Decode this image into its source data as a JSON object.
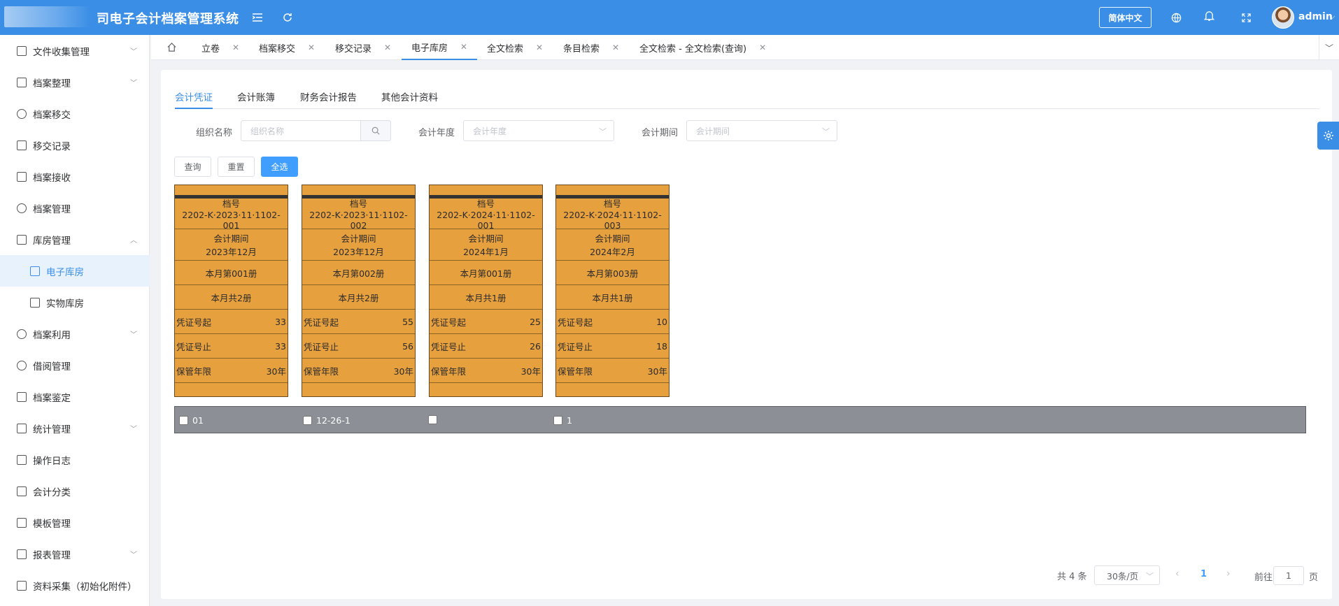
{
  "header": {
    "title": "司电子会计档案管理系统",
    "lang_button": "简体中文",
    "user_name": "admin",
    "icons": [
      "menu-fold-icon",
      "refresh-icon",
      "globe-icon",
      "bell-icon",
      "fullscreen-icon"
    ]
  },
  "sidebar": {
    "items": [
      {
        "label": "文件收集管理",
        "icon": "document-icon",
        "expandable": true
      },
      {
        "label": "档案整理",
        "icon": "grid-icon",
        "expandable": true
      },
      {
        "label": "档案移交",
        "icon": "power-icon"
      },
      {
        "label": "移交记录",
        "icon": "record-icon"
      },
      {
        "label": "档案接收",
        "icon": "receive-icon"
      },
      {
        "label": "档案管理",
        "icon": "manage-icon"
      },
      {
        "label": "库房管理",
        "icon": "warehouse-icon",
        "expanded": true
      },
      {
        "label": "电子库房",
        "icon": "laptop-icon",
        "sub": true,
        "active": true
      },
      {
        "label": "实物库房",
        "icon": "document-icon",
        "sub": true
      },
      {
        "label": "档案利用",
        "icon": "reuse-icon",
        "expandable": true
      },
      {
        "label": "借阅管理",
        "icon": "registered-icon"
      },
      {
        "label": "档案鉴定",
        "icon": "inspect-icon"
      },
      {
        "label": "统计管理",
        "icon": "stats-icon",
        "expandable": true
      },
      {
        "label": "操作日志",
        "icon": "log-icon"
      },
      {
        "label": "会计分类",
        "icon": "category-icon"
      },
      {
        "label": "模板管理",
        "icon": "template-icon"
      },
      {
        "label": "报表管理",
        "icon": "report-icon",
        "expandable": true
      },
      {
        "label": "资料采集（初始化附件）",
        "icon": "edit-icon"
      }
    ]
  },
  "tabs": [
    {
      "label": "立卷"
    },
    {
      "label": "档案移交"
    },
    {
      "label": "移交记录"
    },
    {
      "label": "电子库房",
      "active": true
    },
    {
      "label": "全文检索"
    },
    {
      "label": "条目检索"
    },
    {
      "label": "全文检索 - 全文检索(查询)"
    }
  ],
  "subtabs": [
    "会计凭证",
    "会计账簿",
    "财务会计报告",
    "其他会计资料"
  ],
  "filters": {
    "org_label": "组织名称",
    "org_placeholder": "组织名称",
    "year_label": "会计年度",
    "year_placeholder": "会计年度",
    "period_label": "会计期间",
    "period_placeholder": "会计期间"
  },
  "buttons": {
    "query": "查询",
    "reset": "重置",
    "select_all": "全选"
  },
  "boxes": [
    {
      "dh_label": "档号",
      "dh": "2202-K·2023·11·1102-001",
      "period_label": "会计期间",
      "period": "2023年12月",
      "vol": "本月第001册",
      "total": "本月共2册",
      "start_label": "凭证号起",
      "start": "33",
      "end_label": "凭证号止",
      "end": "33",
      "keep_label": "保管年限",
      "keep": "30年"
    },
    {
      "dh_label": "档号",
      "dh": "2202-K·2023·11·1102-002",
      "period_label": "会计期间",
      "period": "2023年12月",
      "vol": "本月第002册",
      "total": "本月共2册",
      "start_label": "凭证号起",
      "start": "55",
      "end_label": "凭证号止",
      "end": "56",
      "keep_label": "保管年限",
      "keep": "30年"
    },
    {
      "dh_label": "档号",
      "dh": "2202-K·2024·11·1102-001",
      "period_label": "会计期间",
      "period": "2024年1月",
      "vol": "本月第001册",
      "total": "本月共1册",
      "start_label": "凭证号起",
      "start": "25",
      "end_label": "凭证号止",
      "end": "26",
      "keep_label": "保管年限",
      "keep": "30年"
    },
    {
      "dh_label": "档号",
      "dh": "2202-K·2024·11·1102-003",
      "period_label": "会计期间",
      "period": "2024年2月",
      "vol": "本月第003册",
      "total": "本月共1册",
      "start_label": "凭证号起",
      "start": "10",
      "end_label": "凭证号止",
      "end": "18",
      "keep_label": "保管年限",
      "keep": "30年"
    }
  ],
  "strip": [
    "01",
    "12-26-1",
    "",
    "1"
  ],
  "pagination": {
    "total": "共 4 条",
    "page_size": "30条/页",
    "current": "1",
    "goto_prefix": "前往",
    "goto_value": "1",
    "goto_suffix": "页"
  },
  "colors": {
    "accent": "#3a8ee6",
    "box": "#e7a03e",
    "strip": "#8c8f96"
  }
}
